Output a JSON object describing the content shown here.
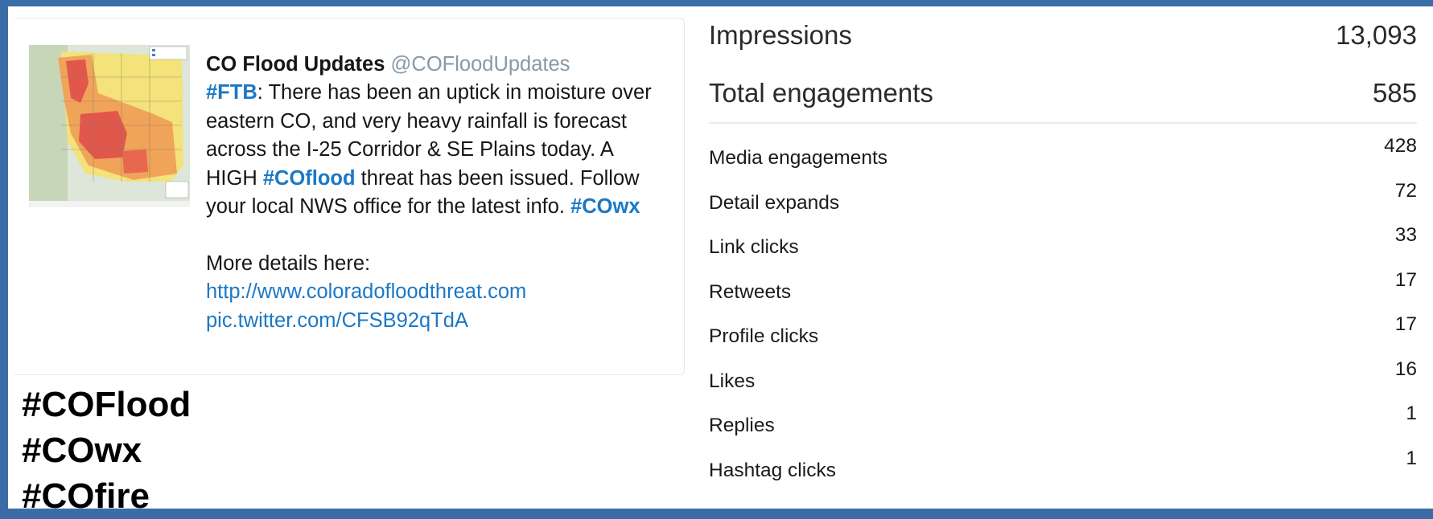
{
  "tweet": {
    "display_name": "CO Flood Updates",
    "handle": "@COFloodUpdates",
    "text": {
      "tag_ftb": "#FTB",
      "segment1": ": There has been an uptick in moisture over eastern CO, and very heavy rainfall is forecast across the I-25 Corridor & SE Plains today. A HIGH ",
      "tag_coflood": "#COflood",
      "segment2": " threat has been issued. Follow your local NWS office for the latest info. ",
      "tag_cowx": "#COwx",
      "details_label": "More details here:",
      "link_url": "http://www.coloradofloodthreat.com",
      "pic_link": "pic.twitter.com/CFSB92qTdA"
    },
    "thumbnail_icon": "flood-threat-map-image"
  },
  "hashtags": [
    "#COFlood",
    "#COwx",
    "#COfire"
  ],
  "analytics": {
    "impressions": {
      "label": "Impressions",
      "value": "13,093"
    },
    "total_engagements": {
      "label": "Total engagements",
      "value": "585"
    },
    "metrics": [
      {
        "label": "Media engagements",
        "value": "428"
      },
      {
        "label": "Detail expands",
        "value": "72"
      },
      {
        "label": "Link clicks",
        "value": "33"
      },
      {
        "label": "Retweets",
        "value": "17"
      },
      {
        "label": "Profile clicks",
        "value": "17"
      },
      {
        "label": "Likes",
        "value": "16"
      },
      {
        "label": "Replies",
        "value": "1"
      },
      {
        "label": "Hashtag clicks",
        "value": "1"
      }
    ]
  },
  "colors": {
    "frame": "#3b6ca8",
    "link": "#1b78c4",
    "handle": "#8899a6"
  }
}
